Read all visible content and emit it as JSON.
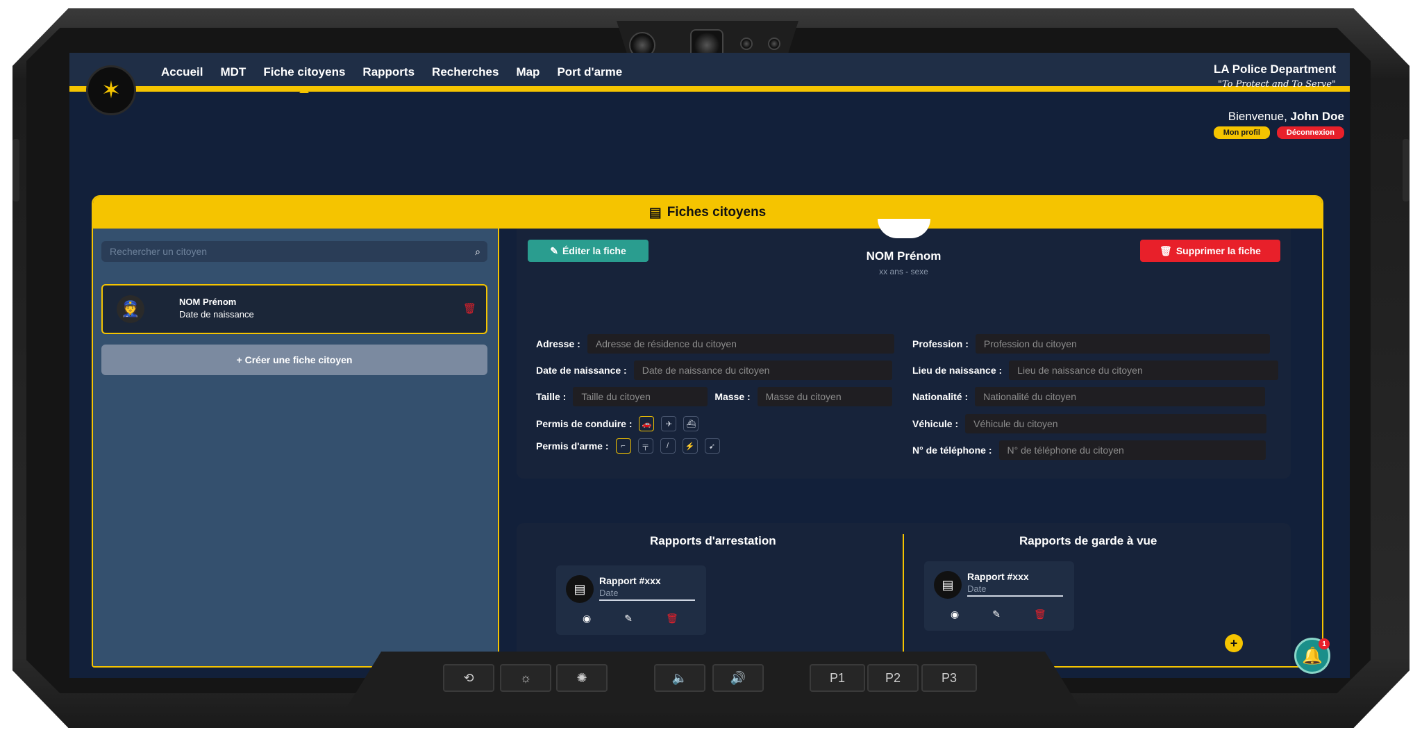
{
  "nav": {
    "items": [
      {
        "label": "Accueil"
      },
      {
        "label": "MDT"
      },
      {
        "label": "Fiche citoyens"
      },
      {
        "label": "Rapports"
      },
      {
        "label": "Recherches"
      },
      {
        "label": "Map"
      },
      {
        "label": "Port d'arme"
      }
    ],
    "active": "Fiche citoyens"
  },
  "brand": {
    "name": "LA Police Department",
    "motto": "\"To Protect and To Serve\""
  },
  "user": {
    "greeting": "Bienvenue, ",
    "name": "John Doe",
    "profile_btn": "Mon profil",
    "logout_btn": "Déconnexion"
  },
  "panel": {
    "title": "Fiches citoyens"
  },
  "sidebar": {
    "search_placeholder": "Rechercher un citoyen",
    "citizen": {
      "name": "NOM Prénom",
      "dob": "Date de naissance"
    },
    "create_btn": "+ Créer une fiche citoyen"
  },
  "profile": {
    "edit_btn": "Éditer la fiche",
    "delete_btn": "Supprimer la fiche",
    "name": "NOM Prénom",
    "sub": "xx ans - sexe",
    "fields": {
      "adresse": {
        "label": "Adresse :",
        "placeholder": "Adresse de résidence du citoyen"
      },
      "dob": {
        "label": "Date de naissance :",
        "placeholder": "Date de naissance du citoyen"
      },
      "taille": {
        "label": "Taille :",
        "placeholder": "Taille du citoyen"
      },
      "masse": {
        "label": "Masse :",
        "placeholder": "Masse du citoyen"
      },
      "permis_conduire": {
        "label": "Permis de conduire :"
      },
      "permis_arme": {
        "label": "Permis d'arme :"
      },
      "profession": {
        "label": "Profession :",
        "placeholder": "Profession du citoyen"
      },
      "lieu": {
        "label": "Lieu de naissance :",
        "placeholder": "Lieu de naissance du citoyen"
      },
      "nationalite": {
        "label": "Nationalité :",
        "placeholder": "Nationalité du citoyen"
      },
      "vehicule": {
        "label": "Véhicule :",
        "placeholder": "Véhicule du citoyen"
      },
      "telephone": {
        "label": "N° de téléphone :",
        "placeholder": "N° de téléphone du citoyen"
      }
    },
    "driving_licenses": [
      "car-icon",
      "plane-icon",
      "boat-icon"
    ],
    "weapon_licenses": [
      "pistol-icon",
      "rifle-icon",
      "knife-icon",
      "taser-icon",
      "hunting-icon"
    ]
  },
  "reports": {
    "arrest": {
      "title": "Rapports d'arrestation",
      "card": {
        "title": "Rapport #xxx",
        "date": "Date"
      }
    },
    "custody": {
      "title": "Rapports de garde à vue",
      "card": {
        "title": "Rapport #xxx",
        "date": "Date"
      }
    }
  },
  "notifications": {
    "count": "1"
  },
  "hardware": {
    "p1": "P1",
    "p2": "P2",
    "p3": "P3"
  },
  "colors": {
    "accent": "#f5c400",
    "danger": "#e8202a",
    "edit": "#2a9d8f",
    "screen_bg": "#12203a"
  }
}
